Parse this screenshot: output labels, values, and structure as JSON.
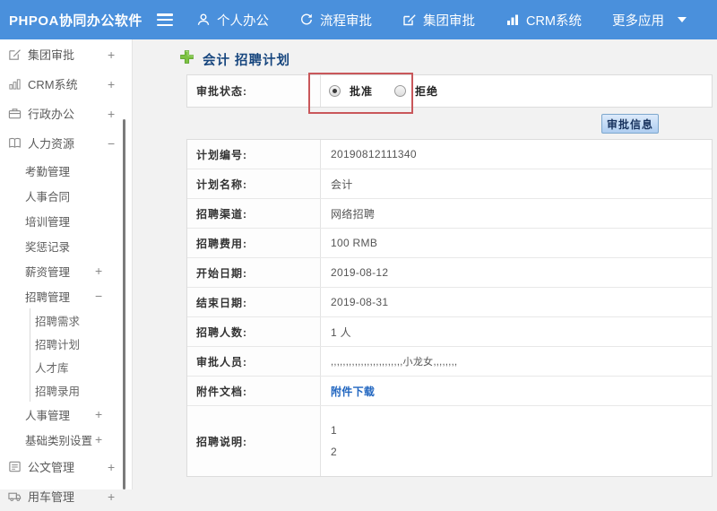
{
  "topbar": {
    "brand": "PHPOA协同办公软件",
    "nav": [
      {
        "label": "个人办公",
        "icon": "person-icon"
      },
      {
        "label": "流程审批",
        "icon": "refresh-icon"
      },
      {
        "label": "集团审批",
        "icon": "edit-icon"
      },
      {
        "label": "CRM系统",
        "icon": "bar-chart-icon"
      },
      {
        "label": "更多应用",
        "icon": "caret-down-icon"
      }
    ]
  },
  "sidebar": {
    "items": [
      {
        "label": "集团审批",
        "icon": "edit-square-icon",
        "expander": "+"
      },
      {
        "label": "CRM系统",
        "icon": "bar-chart-icon",
        "expander": "+"
      },
      {
        "label": "行政办公",
        "icon": "briefcase-icon",
        "expander": "+"
      },
      {
        "label": "人力资源",
        "icon": "book-icon",
        "expander": "−"
      },
      {
        "label": "考勤管理"
      },
      {
        "label": "人事合同"
      },
      {
        "label": "培训管理"
      },
      {
        "label": "奖惩记录"
      },
      {
        "label": "薪资管理",
        "expander": "+"
      },
      {
        "label": "招聘管理",
        "expander": "−"
      },
      {
        "label": "招聘需求"
      },
      {
        "label": "招聘计划"
      },
      {
        "label": "人才库"
      },
      {
        "label": "招聘录用"
      },
      {
        "label": "人事管理",
        "expander": "+"
      },
      {
        "label": "基础类别设置",
        "expander": "+"
      },
      {
        "label": "公文管理",
        "icon": "document-icon",
        "expander": "+"
      },
      {
        "label": "用车管理",
        "icon": "truck-icon",
        "expander": "+"
      }
    ]
  },
  "main": {
    "title": "会计 招聘计划",
    "status": {
      "label": "审批状态:",
      "options": [
        {
          "label": "批准",
          "selected": true
        },
        {
          "label": "拒绝",
          "selected": false
        }
      ]
    },
    "approval_info_button": "审批信息",
    "fields": [
      {
        "label": "计划编号:",
        "value": "20190812111340"
      },
      {
        "label": "计划名称:",
        "value": "会计"
      },
      {
        "label": "招聘渠道:",
        "value": "网络招聘"
      },
      {
        "label": "招聘费用:",
        "value": "100 RMB"
      },
      {
        "label": "开始日期:",
        "value": "2019-08-12"
      },
      {
        "label": "结束日期:",
        "value": "2019-08-31"
      },
      {
        "label": "招聘人数:",
        "value": "1 人"
      },
      {
        "label": "审批人员:",
        "value": ",,,,,,,,,,,,,,,,,,,,,,,,小龙女,,,,,,,,"
      },
      {
        "label": "附件文档:",
        "value": "附件下载",
        "type": "link"
      },
      {
        "label": "招聘说明:",
        "lines": [
          "1",
          "2"
        ]
      }
    ]
  },
  "colors": {
    "topbar_bg": "#4a90dc",
    "annotation_red": "#c9575b",
    "link_blue": "#2166c0",
    "title_blue": "#17467e",
    "button_border": "#7da7cd"
  }
}
